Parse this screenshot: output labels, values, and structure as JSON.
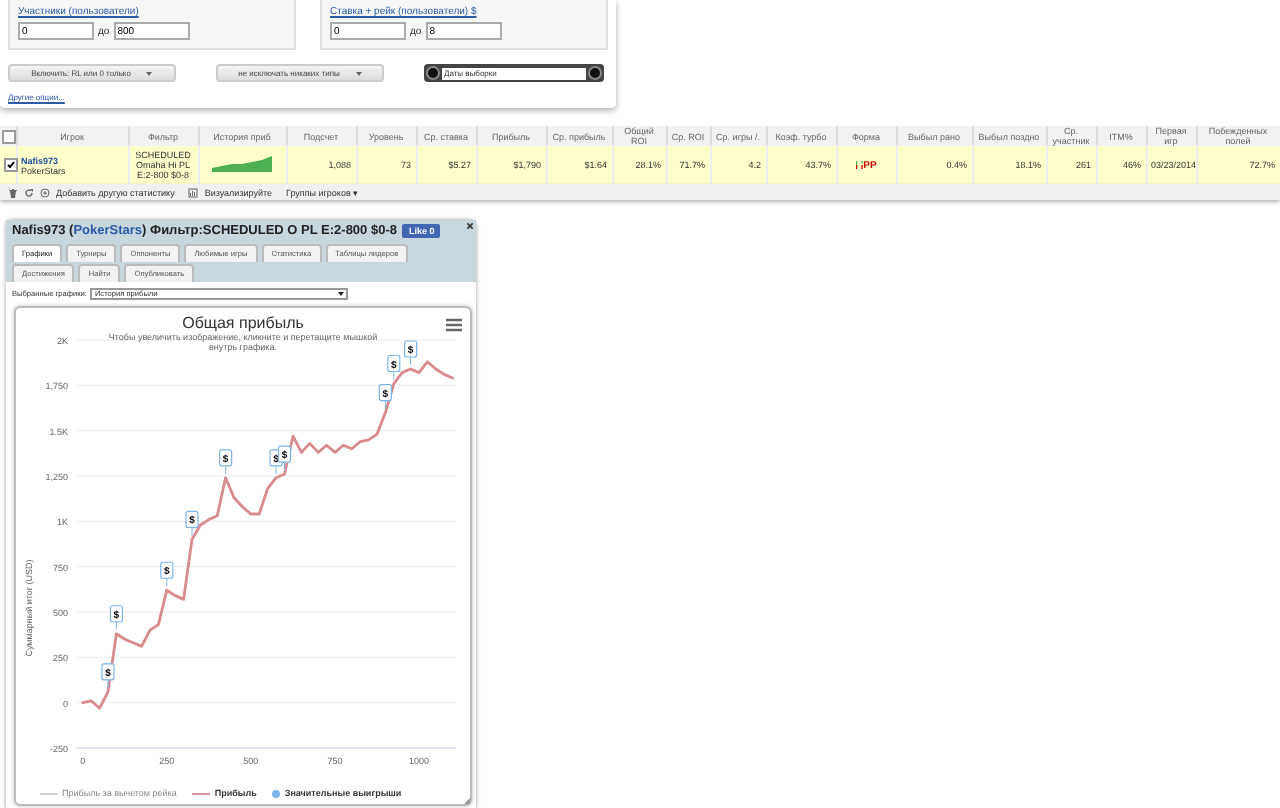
{
  "filters": {
    "participants": {
      "label": "Участники (пользователи)",
      "from": "0",
      "to_label": "до",
      "to": "800"
    },
    "stake": {
      "label": "Ставка + рейк (пользователи) $",
      "from": "0",
      "to_label": "до",
      "to": "8"
    },
    "dropdowns": [
      "Включить: RL или 0 только",
      "не исключать никаких типы"
    ],
    "date_field": {
      "placeholder": "Даты выборки"
    },
    "more_link": "Другие опции..."
  },
  "table": {
    "all_checked": false,
    "columns": [
      "Игрок",
      "Фильтр",
      "История приб",
      "Подсчет",
      "Уровень",
      "Ср. ставка",
      "Прибыль",
      "Ср. прибыль",
      "Общий ROI",
      "Ср. ROI",
      "Ср. игры /.",
      "Коэф. турбо",
      "Форма",
      "Выбыл рано",
      "Выбыл поздно",
      "Ср. участник",
      "ITM%",
      "Первая игр",
      "Побежденных полей"
    ],
    "rows": [
      {
        "checked": true,
        "player": "Nafis973",
        "site": "PokerStars",
        "filter": "SCHEDULED Omaha Hi PL E:2-800 $0-8",
        "before_form": [
          "1,088",
          "73",
          "$5.27",
          "$1,790",
          "$1.64",
          "28.1%",
          "71.7%",
          "4.2",
          "43.7%"
        ],
        "form": "PP",
        "after_form": [
          "0.4%",
          "18.1%",
          "261",
          "46%",
          "03/23/2014",
          "72.7%"
        ]
      }
    ]
  },
  "toolbar": {
    "add_stat": "Добавить другую статистику",
    "visualize": "Визуализируйте",
    "groups": "Группы игроков ▾"
  },
  "widget": {
    "title_before": "Nafis973 (",
    "site": "PokerStars",
    "title_after": ") Фильтр:SCHEDULED O PL E:2-800 $0-8",
    "like": "Like 0",
    "tabs": [
      {
        "label": "Графики",
        "selected": true
      },
      {
        "label": "Турниры",
        "selected": false
      },
      {
        "label": "Оппоненты",
        "selected": false
      },
      {
        "label": "Любимые игры",
        "selected": false
      },
      {
        "label": "Статистика",
        "selected": false
      },
      {
        "label": "Таблицы лидеров",
        "selected": false
      },
      {
        "label": "Достижения",
        "selected": false
      },
      {
        "label": "Найти",
        "selected": false
      },
      {
        "label": "Опубликовать",
        "selected": false
      }
    ],
    "chart_select": {
      "label": "Выбранные графики:",
      "value": "История прибыли"
    },
    "chart": {
      "subtitle": "Чтобы увеличить изображение, кликните и перетащите мышкой внутрь графика.",
      "legend": [
        {
          "label": "Прибыль за вычетом рейка",
          "kind": "line",
          "color": "#cccccc",
          "hidden": true
        },
        {
          "kind": "series",
          "hidden": false
        },
        {
          "label": "Значительные выигрыши",
          "kind": "dot",
          "color": "#7cb5ec",
          "hidden": false
        }
      ],
      "chart_data": {
        "type": "line",
        "title": "Общая прибыль",
        "ylabel": "Суммарный итог (USD)",
        "grid": true,
        "xlim": [
          -20,
          1110
        ],
        "ylim": [
          -250,
          2000
        ],
        "x": [
          0,
          25,
          50,
          75,
          100,
          125,
          150,
          175,
          200,
          225,
          250,
          275,
          300,
          325,
          350,
          375,
          400,
          425,
          450,
          475,
          500,
          525,
          550,
          575,
          600,
          625,
          650,
          675,
          700,
          725,
          750,
          775,
          800,
          825,
          850,
          875,
          900,
          925,
          950,
          975,
          1000,
          1025,
          1050,
          1075,
          1100
        ],
        "series": [
          {
            "name": "Прибыль",
            "color": "#d98a8c",
            "values": [
              0,
              10,
              -30,
              60,
              380,
              350,
              330,
              310,
              400,
              430,
              620,
              590,
              570,
              900,
              980,
              1010,
              1030,
              1240,
              1130,
              1080,
              1040,
              1040,
              1180,
              1240,
              1260,
              1470,
              1380,
              1430,
              1380,
              1420,
              1380,
              1420,
              1400,
              1440,
              1450,
              1480,
              1600,
              1760,
              1820,
              1840,
              1820,
              1880,
              1840,
              1810,
              1790
            ]
          }
        ],
        "xticks": [
          0,
          250,
          500,
          750,
          1000
        ],
        "yticks": [
          {
            "value": -250,
            "label": "-250"
          },
          {
            "value": 0,
            "label": "0"
          },
          {
            "value": 250,
            "label": "250"
          },
          {
            "value": 500,
            "label": "500"
          },
          {
            "value": 750,
            "label": "750"
          },
          {
            "value": 1000,
            "label": "1K"
          },
          {
            "value": 1250,
            "label": "1,250"
          },
          {
            "value": 1500,
            "label": "1.5K"
          },
          {
            "value": 1750,
            "label": "1,750"
          },
          {
            "value": 2000,
            "label": "2K"
          }
        ],
        "annotations": [
          {
            "x": 75,
            "y": 60,
            "text": "$"
          },
          {
            "x": 100,
            "y": 380,
            "text": "$"
          },
          {
            "x": 250,
            "y": 620,
            "text": "$"
          },
          {
            "x": 325,
            "y": 900,
            "text": "$"
          },
          {
            "x": 425,
            "y": 1240,
            "text": "$"
          },
          {
            "x": 575,
            "y": 1240,
            "text": "$"
          },
          {
            "x": 600,
            "y": 1260,
            "text": "$"
          },
          {
            "x": 900,
            "y": 1600,
            "text": "$"
          },
          {
            "x": 925,
            "y": 1760,
            "text": "$"
          },
          {
            "x": 975,
            "y": 1840,
            "text": "$"
          }
        ]
      }
    }
  }
}
